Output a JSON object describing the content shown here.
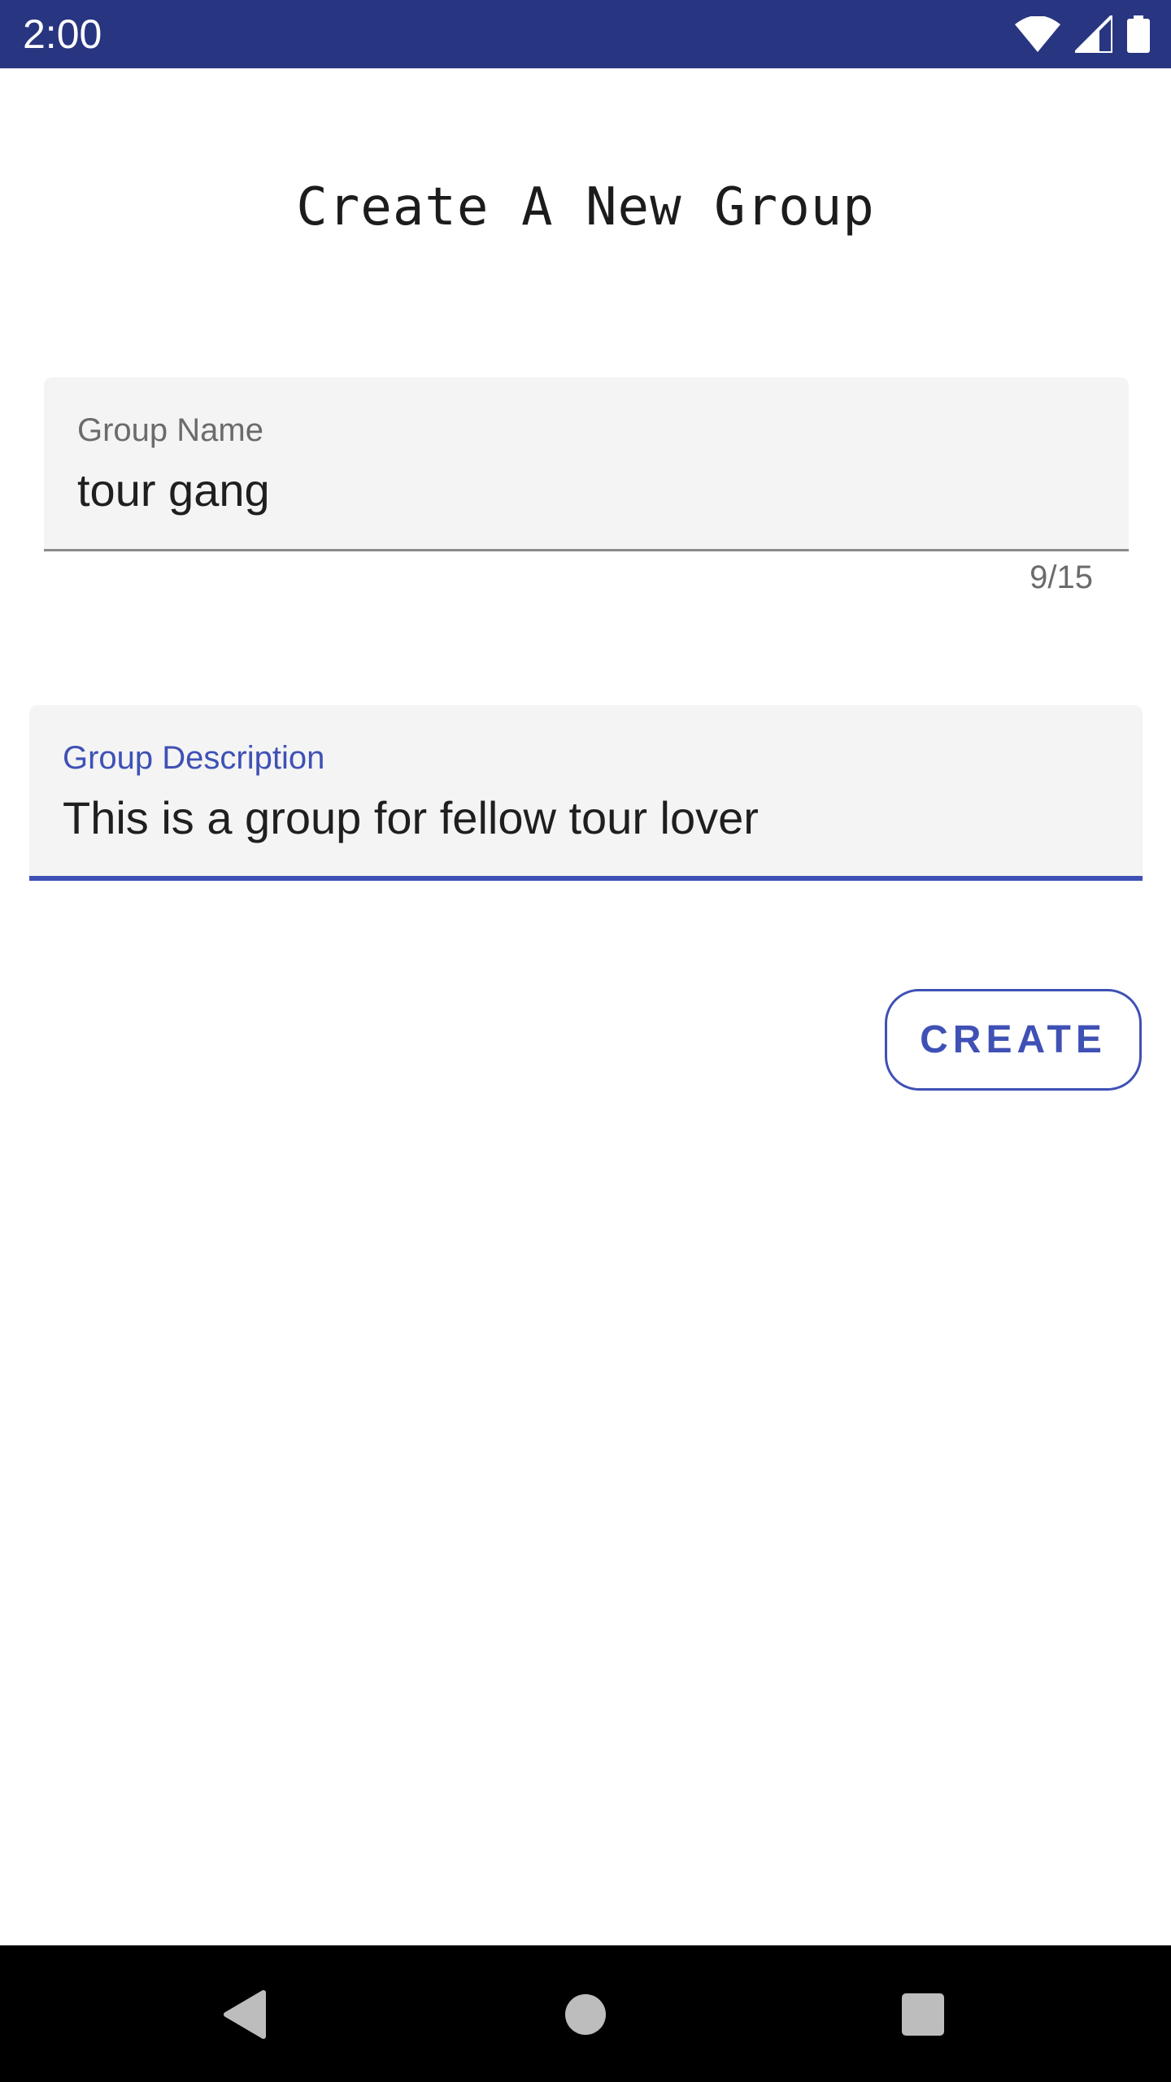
{
  "status_bar": {
    "time": "2:00",
    "background_color": "#283580",
    "icons": [
      "wifi-icon",
      "signal-icon",
      "battery-icon"
    ]
  },
  "page": {
    "title": "Create A New Group"
  },
  "form": {
    "group_name": {
      "label": "Group Name",
      "value": "tour gang",
      "counter": "9/15"
    },
    "group_description": {
      "label": "Group Description",
      "value": "This is a group for fellow tour lover",
      "focused": true
    },
    "create_button_label": "CREATE"
  },
  "theme": {
    "accent": "#3f51b5",
    "field_background": "#f4f4f4"
  },
  "nav_bar": {
    "icons": [
      "back-icon",
      "home-icon",
      "recents-icon"
    ]
  }
}
